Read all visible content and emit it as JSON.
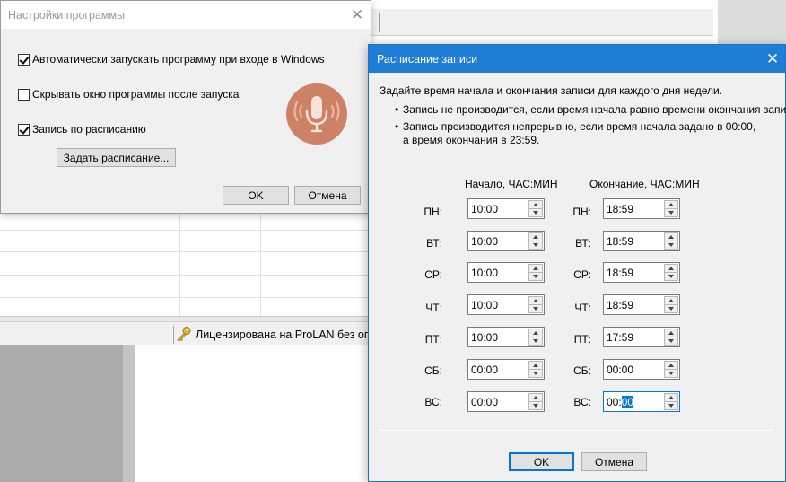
{
  "background": {
    "status_license_text": "Лицензирована на ProLAN без огра"
  },
  "settings_dialog": {
    "title": "Настройки программы",
    "close_glyph": "✕",
    "autostart_label": "Автоматически запускать программу при входе в Windows",
    "autostart_checked": true,
    "hide_window_label": "Скрывать окно программы после запуска",
    "hide_window_checked": false,
    "scheduled_label": "Запись по расписанию",
    "scheduled_checked": true,
    "set_schedule_button": "Задать расписание...",
    "ok_button": "OK",
    "cancel_button": "Отмена",
    "logo_icon": "microphone-icon",
    "logo_color": "#cd8266"
  },
  "schedule_dialog": {
    "title": "Расписание записи",
    "close_glyph": "✕",
    "intro": "Задайте время начала и окончания записи для каждого дня недели.",
    "bullet_1": "Запись не производится, если время начала равно времени окончания записи.",
    "bullet_2_line1": "Запись производится непрерывно, если время начала задано в 00:00,",
    "bullet_2_line2": "а время окончания в 23:59.",
    "start_header": "Начало, ЧАС:МИН",
    "end_header": "Окончание, ЧАС:МИН",
    "days": [
      {
        "label": "ПН:",
        "start": "10:00",
        "end": "18:59"
      },
      {
        "label": "ВТ:",
        "start": "10:00",
        "end": "18:59"
      },
      {
        "label": "СР:",
        "start": "10:00",
        "end": "18:59"
      },
      {
        "label": "ЧТ:",
        "start": "10:00",
        "end": "18:59"
      },
      {
        "label": "ПТ:",
        "start": "10:00",
        "end": "17:59"
      },
      {
        "label": "СБ:",
        "start": "00:00",
        "end": "00:00"
      },
      {
        "label": "ВС:",
        "start": "00:00",
        "end_prefix": "00:",
        "end_selected": "00"
      }
    ],
    "ok_button": "OK",
    "cancel_button": "Отмена",
    "title_bar_color": "#1e7dd4"
  }
}
